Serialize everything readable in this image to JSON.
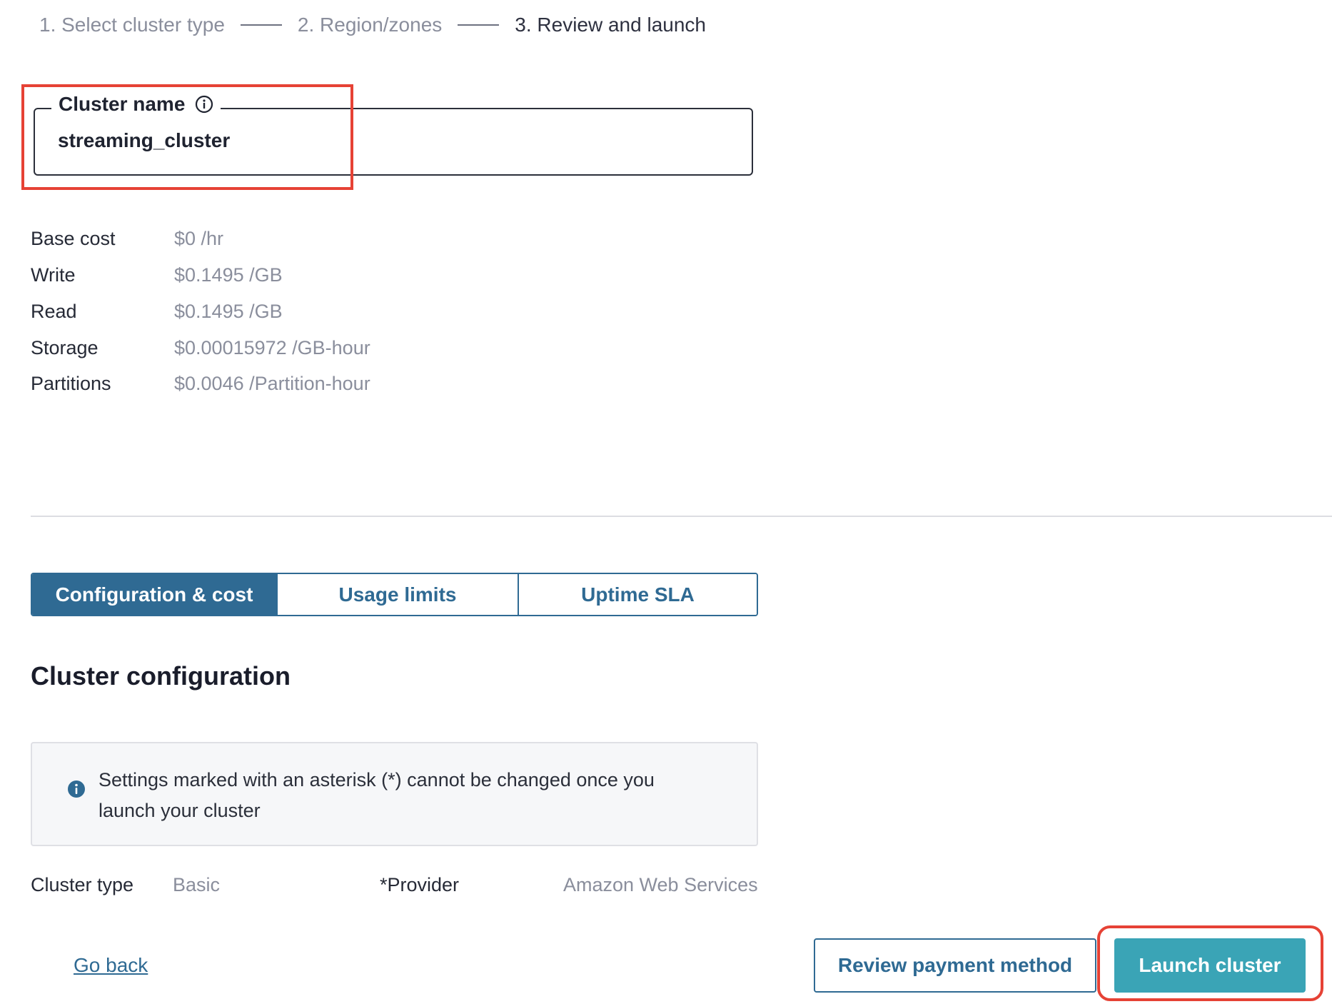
{
  "stepper": {
    "steps": [
      {
        "label": "1. Select cluster type",
        "state": "done"
      },
      {
        "label": "2. Region/zones",
        "state": "done"
      },
      {
        "label": "3. Review and launch",
        "state": "current"
      }
    ]
  },
  "cluster_name": {
    "label": "Cluster name",
    "value": "streaming_cluster",
    "icon": "info-icon"
  },
  "costs": [
    {
      "label": "Base cost",
      "value": "$0 /hr"
    },
    {
      "label": "Write",
      "value": "$0.1495 /GB"
    },
    {
      "label": "Read",
      "value": "$0.1495 /GB"
    },
    {
      "label": "Storage",
      "value": "$0.00015972 /GB-hour"
    },
    {
      "label": "Partitions",
      "value": "$0.0046 /Partition-hour"
    }
  ],
  "tabs": [
    {
      "label": "Configuration & cost",
      "active": true
    },
    {
      "label": "Usage limits",
      "active": false
    },
    {
      "label": "Uptime SLA",
      "active": false
    }
  ],
  "section": {
    "title": "Cluster configuration"
  },
  "banner": {
    "text": "Settings marked with an asterisk (*) cannot be changed once you launch your cluster",
    "icon": "info-circle-icon"
  },
  "config": {
    "cluster_type_label": "Cluster type",
    "cluster_type_value": "Basic",
    "provider_label": "*Provider",
    "provider_value": "Amazon Web Services"
  },
  "footer": {
    "go_back": "Go back",
    "review_payment": "Review payment method",
    "launch": "Launch cluster"
  },
  "colors": {
    "accent": "#2f6a93",
    "primary_button": "#3aa4b6",
    "highlight": "#e64235",
    "muted_text": "#8a8e9c"
  }
}
